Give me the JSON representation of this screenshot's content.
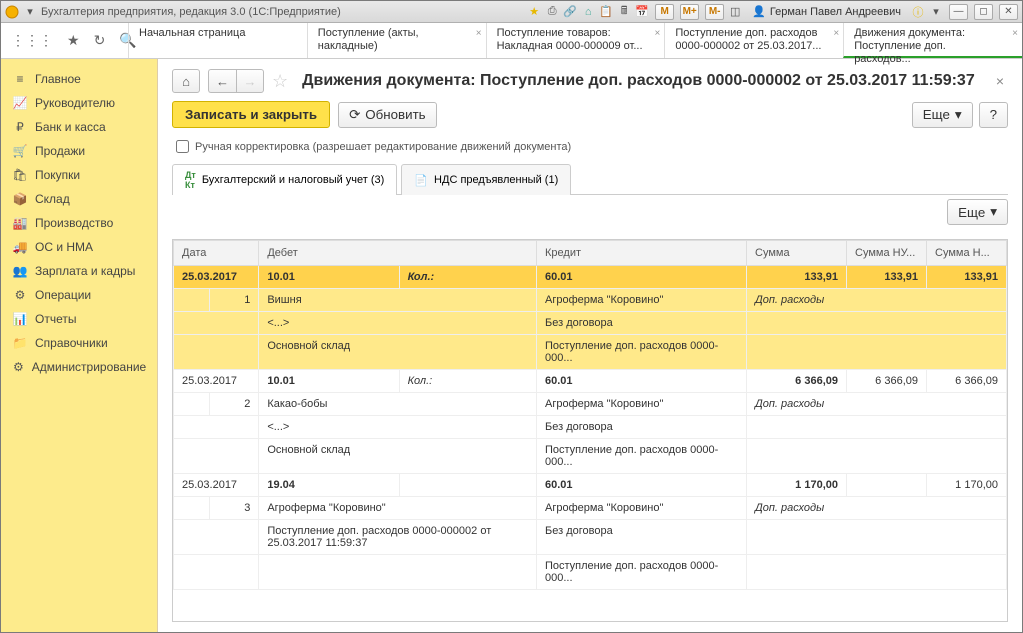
{
  "window": {
    "title": "Бухгалтерия предприятия, редакция 3.0  (1С:Предприятие)",
    "user": "Герман Павел Андреевич",
    "m_labels": [
      "M",
      "M+",
      "M-"
    ]
  },
  "toptabs": [
    {
      "l1": "Начальная страница",
      "l2": ""
    },
    {
      "l1": "Поступление (акты, накладные)",
      "l2": ""
    },
    {
      "l1": "Поступление товаров:",
      "l2": "Накладная 0000-000009 от..."
    },
    {
      "l1": "Поступление доп. расходов",
      "l2": "0000-000002 от 25.03.2017..."
    },
    {
      "l1": "Движения документа:",
      "l2": "Поступление доп. расходов...",
      "active": true
    }
  ],
  "sidebar": [
    {
      "label": "Главное",
      "icon": "menu"
    },
    {
      "label": "Руководителю",
      "icon": "chart"
    },
    {
      "label": "Банк и касса",
      "icon": "coin"
    },
    {
      "label": "Продажи",
      "icon": "cart-out"
    },
    {
      "label": "Покупки",
      "icon": "cart-in"
    },
    {
      "label": "Склад",
      "icon": "box"
    },
    {
      "label": "Производство",
      "icon": "factory"
    },
    {
      "label": "ОС и НМА",
      "icon": "truck"
    },
    {
      "label": "Зарплата и кадры",
      "icon": "people"
    },
    {
      "label": "Операции",
      "icon": "ops"
    },
    {
      "label": "Отчеты",
      "icon": "report"
    },
    {
      "label": "Справочники",
      "icon": "folder"
    },
    {
      "label": "Администрирование",
      "icon": "gear"
    }
  ],
  "doc": {
    "title": "Движения документа: Поступление доп. расходов 0000-000002 от 25.03.2017 11:59:37",
    "save_close": "Записать и закрыть",
    "refresh": "Обновить",
    "more": "Еще",
    "help": "?",
    "manual_edit": "Ручная корректировка (разрешает редактирование движений документа)"
  },
  "tabs": [
    {
      "label": "Бухгалтерский и налоговый учет (3)",
      "active": true
    },
    {
      "label": "НДС предъявленный (1)",
      "active": false
    }
  ],
  "grid": {
    "more": "Еще",
    "headers": [
      "Дата",
      "Дебет",
      "Кредит",
      "Сумма",
      "Сумма НУ...",
      "Сумма Н..."
    ],
    "rows": [
      {
        "sel": true,
        "n": "1",
        "date": "25.03.2017",
        "debit": [
          "10.01",
          "Вишня",
          "<...>",
          "Основной склад"
        ],
        "kol": "Кол.:",
        "credit": [
          "60.01",
          "Агроферма \"Коровино\"",
          "Без договора",
          "Поступление доп. расходов 0000-000..."
        ],
        "sum": "133,91",
        "sumnu": "133,91",
        "sumn": "133,91",
        "note": "Доп. расходы"
      },
      {
        "sel": false,
        "n": "2",
        "date": "25.03.2017",
        "debit": [
          "10.01",
          "Какао-бобы",
          "<...>",
          "Основной склад"
        ],
        "kol": "Кол.:",
        "credit": [
          "60.01",
          "Агроферма \"Коровино\"",
          "Без договора",
          "Поступление доп. расходов 0000-000..."
        ],
        "sum": "6 366,09",
        "sumnu": "6 366,09",
        "sumn": "6 366,09",
        "note": "Доп. расходы"
      },
      {
        "sel": false,
        "n": "3",
        "date": "25.03.2017",
        "debit": [
          "19.04",
          "Агроферма \"Коровино\"",
          "Поступление доп. расходов 0000-000002 от 25.03.2017 11:59:37",
          ""
        ],
        "kol": "",
        "credit": [
          "60.01",
          "Агроферма \"Коровино\"",
          "Без договора",
          "Поступление доп. расходов 0000-000..."
        ],
        "sum": "1 170,00",
        "sumnu": "",
        "sumn": "1 170,00",
        "note": "Доп. расходы"
      }
    ]
  }
}
